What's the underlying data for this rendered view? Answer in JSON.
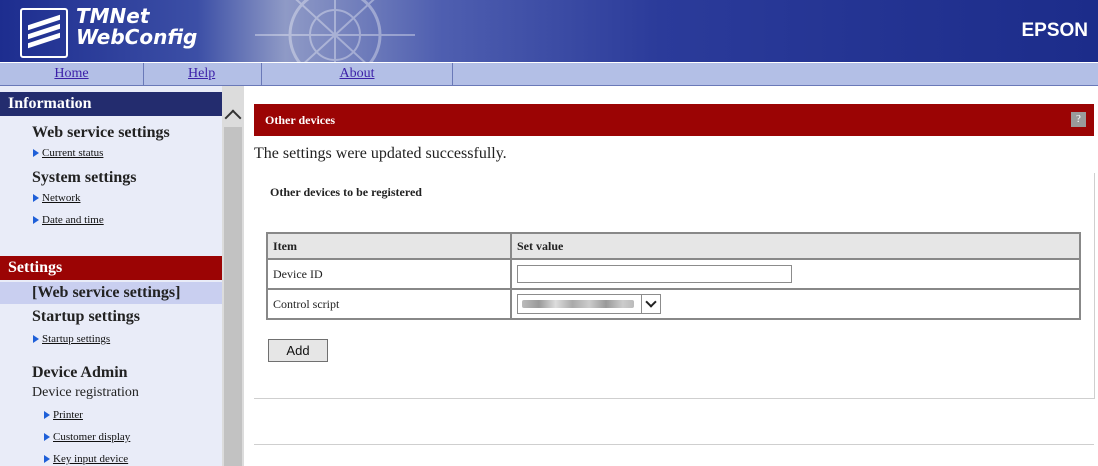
{
  "header": {
    "logo_line1": "TMNet",
    "logo_line2": "WebConfig",
    "brand": "EPSON"
  },
  "nav": {
    "home": "Home",
    "help": "Help",
    "about": "About"
  },
  "sidebar": {
    "information_title": "Information",
    "web_service_settings": "Web service settings",
    "current_status": "Current status",
    "system_settings": "System settings",
    "network": "Network",
    "date_and_time": "Date and time",
    "settings_title": "Settings",
    "web_service_settings_selected": "[Web service settings]",
    "startup_settings_heading": "Startup settings",
    "startup_settings_link": "Startup settings",
    "device_admin": "Device Admin",
    "device_registration": "Device registration",
    "printer": "Printer",
    "customer_display": "Customer display",
    "key_input_device": "Key input device"
  },
  "main": {
    "panel_title": "Other devices",
    "help_icon": "?",
    "success_message": "The settings were updated successfully.",
    "section_title": "Other devices to be registered",
    "table_headers": {
      "item": "Item",
      "set_value": "Set value"
    },
    "rows": {
      "device_id_label": "Device ID",
      "control_script_label": "Control script"
    },
    "device_id_value": "",
    "add_button": "Add"
  },
  "colors": {
    "accent_red": "#9b0404",
    "nav_blue": "#232c6e",
    "link": "#3b1fa8"
  }
}
